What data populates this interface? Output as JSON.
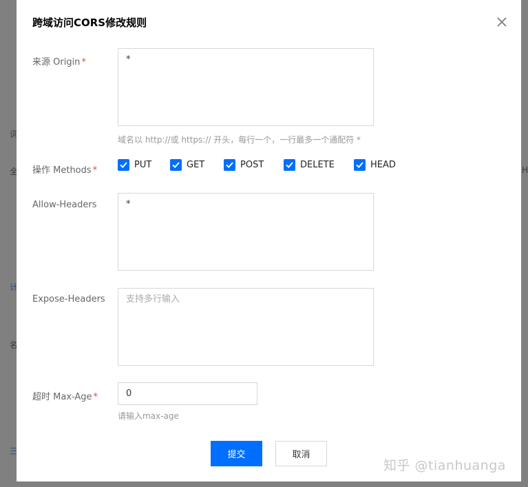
{
  "dialog": {
    "title": "跨域访问CORS修改规则",
    "origin": {
      "label": "来源 Origin",
      "required_mark": "*",
      "value": "*",
      "hint": "域名以 http://或 https:// 开头，每行一个，一行最多一个通配符 *"
    },
    "methods": {
      "label": "操作 Methods",
      "required_mark": "*",
      "options": [
        {
          "label": "PUT",
          "checked": true
        },
        {
          "label": "GET",
          "checked": true
        },
        {
          "label": "POST",
          "checked": true
        },
        {
          "label": "DELETE",
          "checked": true
        },
        {
          "label": "HEAD",
          "checked": true
        }
      ]
    },
    "allow_headers": {
      "label": "Allow-Headers",
      "value": "*"
    },
    "expose_headers": {
      "label": "Expose-Headers",
      "value": "",
      "placeholder": "支持多行输入"
    },
    "max_age": {
      "label": "超时 Max-Age",
      "required_mark": "*",
      "value": "0",
      "hint": "请输入max-age"
    },
    "buttons": {
      "submit": "提交",
      "cancel": "取消"
    }
  },
  "watermark": "知乎 @tianhuanga",
  "colors": {
    "accent": "#006eff",
    "required": "#e54545"
  }
}
